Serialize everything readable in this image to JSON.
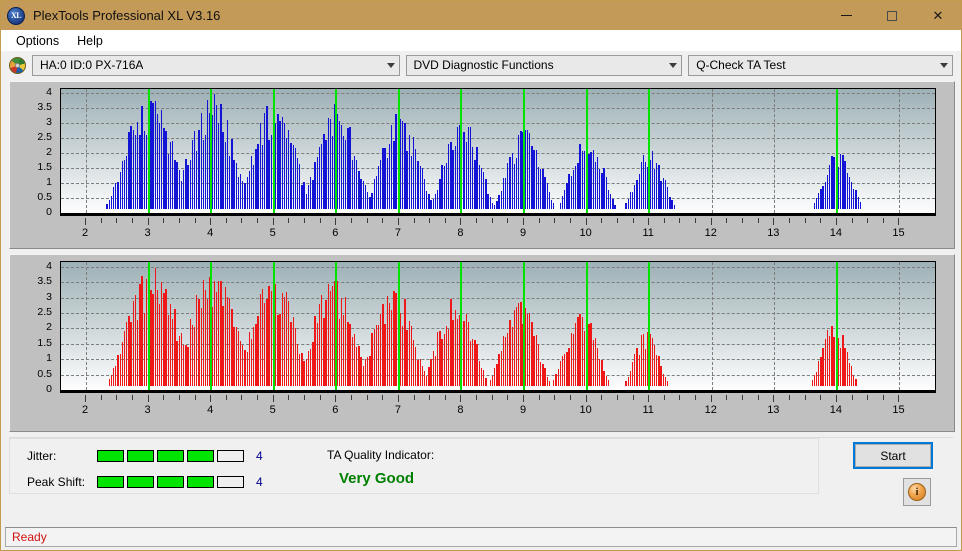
{
  "window": {
    "title": "PlexTools Professional XL V3.16",
    "app_icon": "xl-logo-icon",
    "minimize": "minimize-icon",
    "maximize": "maximize-icon",
    "close": "close-icon"
  },
  "menubar": {
    "items": [
      {
        "label": "Options"
      },
      {
        "label": "Help"
      }
    ]
  },
  "toolbar": {
    "drive": "HA:0 ID:0  PX-716A",
    "function": "DVD Diagnostic Functions",
    "test": "Q-Check TA Test"
  },
  "results": {
    "jitter_label": "Jitter:",
    "jitter_value": "4",
    "jitter_filled": 4,
    "jitter_total": 5,
    "peak_shift_label": "Peak Shift:",
    "peak_shift_value": "4",
    "peak_shift_filled": 4,
    "peak_shift_total": 5,
    "ta_title": "TA Quality Indicator:",
    "ta_value": "Very Good",
    "ta_color": "#008000",
    "meter_on_color": "#00e400",
    "start_label": "Start",
    "info_label": "i"
  },
  "statusbar": {
    "text": "Ready"
  },
  "chart_data": [
    {
      "id": "chart-top",
      "type": "bar",
      "title": "",
      "xlabel": "",
      "ylabel": "",
      "color": "#1414d6",
      "xlim": [
        1.6,
        15.6
      ],
      "ylim": [
        -0.12,
        4.15
      ],
      "yticks": [
        0,
        0.5,
        1,
        1.5,
        2,
        2.5,
        3,
        3.5,
        4
      ],
      "ytick_labels": [
        "0",
        "0.5",
        "1",
        "1.5",
        "2",
        "2.5",
        "3",
        "3.5",
        "4"
      ],
      "xticks": [
        2,
        3,
        4,
        5,
        6,
        7,
        8,
        9,
        10,
        11,
        12,
        13,
        14,
        15
      ],
      "xtick_labels": [
        "2",
        "3",
        "4",
        "5",
        "6",
        "7",
        "8",
        "9",
        "10",
        "11",
        "12",
        "13",
        "14",
        "15"
      ],
      "grid": true,
      "markers": [
        3,
        4,
        5,
        6,
        7,
        8,
        9,
        10,
        11,
        14
      ],
      "marker_color": "#00e400",
      "peaks": [
        {
          "center": 3.0,
          "height": 3.75,
          "halfwidth": 0.48
        },
        {
          "center": 4.0,
          "height": 3.72,
          "halfwidth": 0.44
        },
        {
          "center": 5.0,
          "height": 3.55,
          "halfwidth": 0.42
        },
        {
          "center": 6.0,
          "height": 3.35,
          "halfwidth": 0.4
        },
        {
          "center": 7.0,
          "height": 3.1,
          "halfwidth": 0.38
        },
        {
          "center": 8.0,
          "height": 2.95,
          "halfwidth": 0.36
        },
        {
          "center": 9.0,
          "height": 2.68,
          "halfwidth": 0.34
        },
        {
          "center": 10.0,
          "height": 2.45,
          "halfwidth": 0.32
        },
        {
          "center": 11.0,
          "height": 1.88,
          "halfwidth": 0.28
        },
        {
          "center": 14.0,
          "height": 1.88,
          "halfwidth": 0.28
        }
      ]
    },
    {
      "id": "chart-bot",
      "type": "bar",
      "title": "",
      "xlabel": "",
      "ylabel": "",
      "color": "#ef1818",
      "xlim": [
        1.6,
        15.6
      ],
      "ylim": [
        -0.12,
        4.15
      ],
      "yticks": [
        0,
        0.5,
        1,
        1.5,
        2,
        2.5,
        3,
        3.5,
        4
      ],
      "ytick_labels": [
        "0",
        "0.5",
        "1",
        "1.5",
        "2",
        "2.5",
        "3",
        "3.5",
        "4"
      ],
      "xticks": [
        2,
        3,
        4,
        5,
        6,
        7,
        8,
        9,
        10,
        11,
        12,
        13,
        14,
        15
      ],
      "xtick_labels": [
        "2",
        "3",
        "4",
        "5",
        "6",
        "7",
        "8",
        "9",
        "10",
        "11",
        "12",
        "13",
        "14",
        "15"
      ],
      "grid": true,
      "markers": [
        3,
        4,
        5,
        6,
        7,
        8,
        9,
        10,
        11,
        14
      ],
      "marker_color": "#00e400",
      "peaks": [
        {
          "center": 3.05,
          "height": 3.74,
          "halfwidth": 0.5
        },
        {
          "center": 4.02,
          "height": 3.7,
          "halfwidth": 0.46
        },
        {
          "center": 4.98,
          "height": 3.55,
          "halfwidth": 0.44
        },
        {
          "center": 5.95,
          "height": 3.38,
          "halfwidth": 0.42
        },
        {
          "center": 6.9,
          "height": 3.18,
          "halfwidth": 0.4
        },
        {
          "center": 7.9,
          "height": 2.98,
          "halfwidth": 0.36
        },
        {
          "center": 8.92,
          "height": 2.74,
          "halfwidth": 0.34
        },
        {
          "center": 9.9,
          "height": 2.4,
          "halfwidth": 0.32
        },
        {
          "center": 10.95,
          "height": 1.68,
          "halfwidth": 0.24
        },
        {
          "center": 13.95,
          "height": 1.95,
          "halfwidth": 0.26
        }
      ]
    }
  ]
}
